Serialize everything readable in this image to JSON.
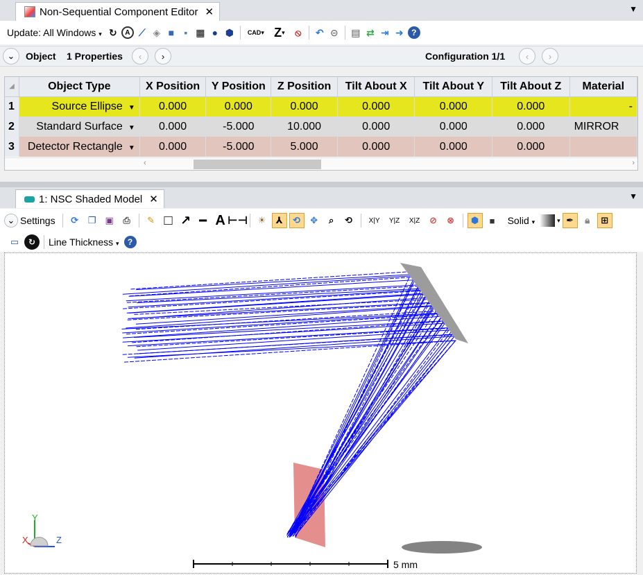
{
  "editor": {
    "tab_title": "Non-Sequential Component Editor",
    "update_label": "Update: All Windows",
    "object_label": "Object",
    "properties_label": "1 Properties",
    "configuration_label": "Configuration 1/1",
    "columns": [
      "Object Type",
      "X Position",
      "Y Position",
      "Z Position",
      "Tilt About X",
      "Tilt About Y",
      "Tilt About Z",
      "Material"
    ],
    "rows": [
      {
        "num": "1",
        "type": "Source Ellipse",
        "x": "0.000",
        "y": "0.000",
        "z": "0.000",
        "tx": "0.000",
        "ty": "0.000",
        "tz": "0.000",
        "material": "-"
      },
      {
        "num": "2",
        "type": "Standard Surface",
        "x": "0.000",
        "y": "-5.000",
        "z": "10.000",
        "tx": "0.000",
        "ty": "0.000",
        "tz": "0.000",
        "material": "MIRROR"
      },
      {
        "num": "3",
        "type": "Detector Rectangle",
        "x": "0.000",
        "y": "-5.000",
        "z": "5.000",
        "tx": "0.000",
        "ty": "0.000",
        "tz": "0.000",
        "material": ""
      }
    ],
    "row_colors": [
      "#e6e61f",
      "#dcdcdc",
      "#e2c6bd"
    ]
  },
  "viewer": {
    "tab_title": "1: NSC Shaded Model",
    "settings_label": "Settings",
    "render_mode": "Solid",
    "line_thickness_label": "Line Thickness",
    "axis_labels": {
      "x": "X",
      "y": "Y",
      "z": "Z"
    },
    "scale_label": "5 mm",
    "toolbar_labels": {
      "cad": "CAD",
      "xy": "X|Y",
      "yz": "Y|Z",
      "xz": "X|Z",
      "z": "Z"
    }
  },
  "colors": {
    "accent": "#0a63c9",
    "ray": "#0000ff",
    "mirror": "#9c9c9c",
    "detector": "#e07a7a"
  }
}
